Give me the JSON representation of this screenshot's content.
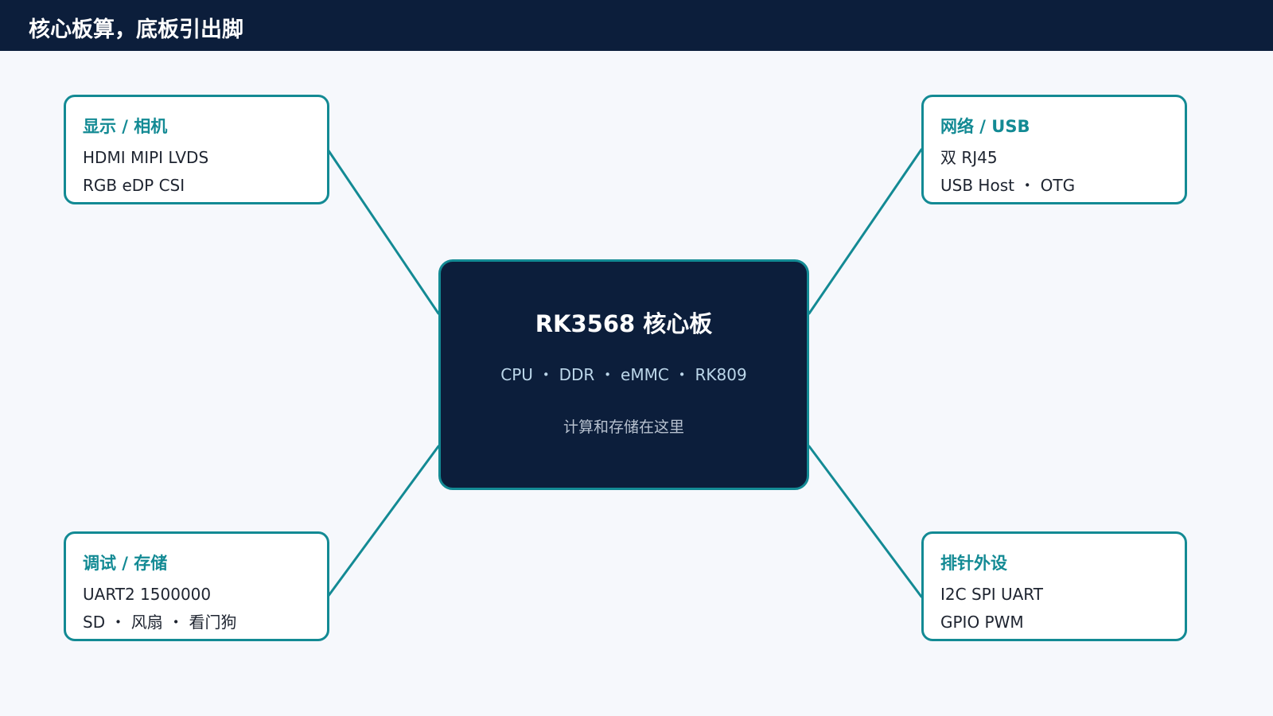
{
  "header": {
    "title": "核心板算，底板引出脚"
  },
  "core": {
    "title": "RK3568 核心板",
    "spec": "CPU ・ DDR ・ eMMC ・ RK809",
    "note": "计算和存储在这里"
  },
  "nodes": {
    "display": {
      "title": "显示 / 相机",
      "line1": "HDMI MIPI LVDS",
      "line2": "RGB eDP CSI"
    },
    "network": {
      "title": "网络 / USB",
      "line1": "双 RJ45",
      "line2": "USB Host ・ OTG"
    },
    "debug": {
      "title": "调试 / 存储",
      "line1": "UART2 1500000",
      "line2": "SD ・ 风扇 ・ 看门狗"
    },
    "header_pins": {
      "title": "排针外设",
      "line1": "I2C SPI UART",
      "line2": "GPIO PWM"
    }
  },
  "colors": {
    "navy": "#0c1e3b",
    "teal": "#138a94",
    "background": "#f6f8fc"
  }
}
